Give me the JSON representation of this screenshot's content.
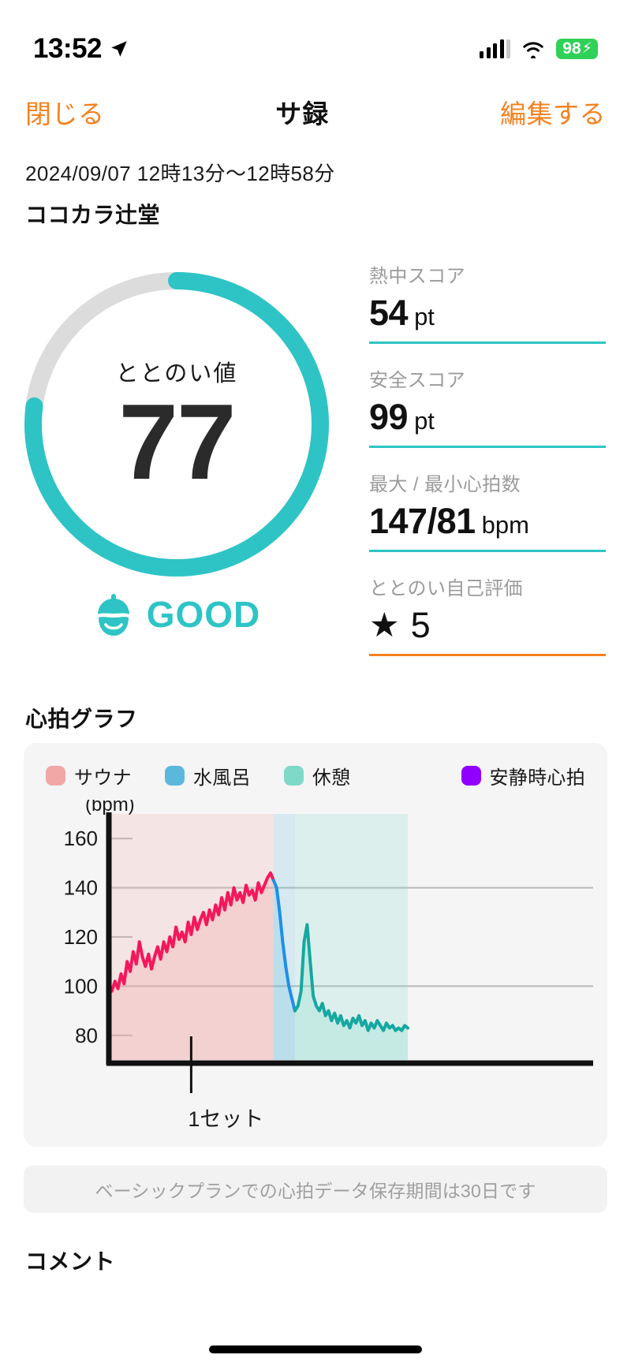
{
  "status_bar": {
    "time": "13:52",
    "location_icon": "location-arrow-icon",
    "signal_icon": "cellular-signal-icon",
    "wifi_icon": "wifi-icon",
    "battery_level": "98",
    "battery_charging_icon": "lightning-bolt-icon"
  },
  "nav": {
    "close_label": "閉じる",
    "title": "サ録",
    "edit_label": "編集する",
    "accent_color": "#F5811F"
  },
  "meta": {
    "date_range": "2024/09/07 12時13分〜12時58分",
    "place": "ココカラ辻堂"
  },
  "gauge": {
    "label": "ととのい値",
    "value": "77",
    "percent": 77,
    "track_color": "#DCDCDC",
    "arc_color": "#2EC4C6",
    "verdict": "GOOD",
    "verdict_icon": "sauna-hat-mascot-icon",
    "verdict_color": "#2EC4C6"
  },
  "stats": [
    {
      "label": "熱中スコア",
      "value": "54",
      "unit": "pt",
      "rule_color": "#2EC4C6",
      "type": "number"
    },
    {
      "label": "安全スコア",
      "value": "99",
      "unit": "pt",
      "rule_color": "#2EC4C6",
      "type": "number"
    },
    {
      "label": "最大 / 最小心拍数",
      "value": "147/81",
      "unit": "bpm",
      "rule_color": "#2EC4C6",
      "type": "number"
    },
    {
      "label": "ととのい自己評価",
      "value": "5",
      "unit": "",
      "star": "★",
      "rule_color": "#F5811F",
      "type": "stars"
    }
  ],
  "chart_section": {
    "title": "心拍グラフ",
    "note": "ベーシックプランでの心拍データ保存期間は30日です"
  },
  "comment_section": {
    "title": "コメント"
  },
  "chart_data": {
    "type": "line",
    "title": "心拍グラフ",
    "ylabel": "(bpm)",
    "xlabel": "",
    "ylim": [
      70,
      170
    ],
    "yticks": [
      80,
      100,
      120,
      140,
      160
    ],
    "ytick_labels": [
      "80",
      "100",
      "120",
      "140",
      "160"
    ],
    "gridlines": [
      100,
      140
    ],
    "grid": true,
    "legend_position": "top",
    "x_annotations": [
      {
        "label": "1セット",
        "x_fraction": 0.17
      }
    ],
    "legend": [
      {
        "name": "サウナ",
        "color": "#F2A7A7"
      },
      {
        "name": "水風呂",
        "color": "#5BB8DC"
      },
      {
        "name": "休憩",
        "color": "#7FD9C8"
      },
      {
        "name": "安静時心拍",
        "color": "#8F00FF"
      }
    ],
    "series": [
      {
        "name": "サウナ",
        "line_color": "#F5175B",
        "fill_color": "rgba(242,167,167,0.30)",
        "phase_band_color": "rgba(242,167,167,0.22)",
        "x": [
          0,
          1,
          2,
          3,
          4,
          5,
          6,
          7,
          8,
          9,
          10,
          11,
          12,
          13,
          14,
          15,
          16,
          17,
          18,
          19,
          20,
          21,
          22,
          23,
          24,
          25,
          26,
          27,
          28,
          29,
          30,
          31,
          32,
          33,
          34,
          35,
          36,
          37,
          38,
          39,
          40,
          41,
          42,
          43,
          44,
          45,
          46,
          47,
          48,
          49,
          50,
          51,
          52,
          53,
          54
        ],
        "values": [
          100,
          98,
          102,
          99,
          105,
          101,
          110,
          106,
          114,
          109,
          118,
          112,
          108,
          113,
          107,
          112,
          116,
          111,
          118,
          114,
          120,
          116,
          124,
          119,
          122,
          118,
          126,
          121,
          128,
          123,
          127,
          130,
          125,
          131,
          127,
          133,
          129,
          136,
          131,
          138,
          133,
          140,
          135,
          138,
          134,
          141,
          137,
          139,
          135,
          142,
          138,
          141,
          144,
          146,
          143
        ]
      },
      {
        "name": "水風呂",
        "line_color": "#1D8FE8",
        "fill_color": "rgba(91,184,220,0.22)",
        "phase_band_color": "rgba(91,184,220,0.20)",
        "x": [
          54,
          55,
          56,
          57,
          58,
          59,
          60,
          61
        ],
        "values": [
          143,
          140,
          130,
          118,
          108,
          100,
          95,
          90
        ]
      },
      {
        "name": "休憩",
        "line_color": "#14A8A0",
        "fill_color": "rgba(127,217,200,0.25)",
        "phase_band_color": "rgba(127,217,200,0.20)",
        "x": [
          61,
          62,
          63,
          64,
          65,
          66,
          67,
          68,
          69,
          70,
          71,
          72,
          73,
          74,
          75,
          76,
          77,
          78,
          79,
          80,
          81,
          82,
          83,
          84,
          85,
          86,
          87,
          88,
          89,
          90,
          91,
          92,
          93,
          94,
          95,
          96,
          97,
          98
        ],
        "values": [
          90,
          92,
          98,
          118,
          125,
          110,
          96,
          92,
          90,
          93,
          88,
          90,
          86,
          89,
          85,
          88,
          84,
          86,
          83,
          87,
          85,
          88,
          84,
          86,
          82,
          85,
          83,
          86,
          84,
          82,
          85,
          83,
          84,
          82,
          83,
          82,
          84,
          83
        ]
      }
    ],
    "max_hr": 147,
    "min_hr": 81
  }
}
